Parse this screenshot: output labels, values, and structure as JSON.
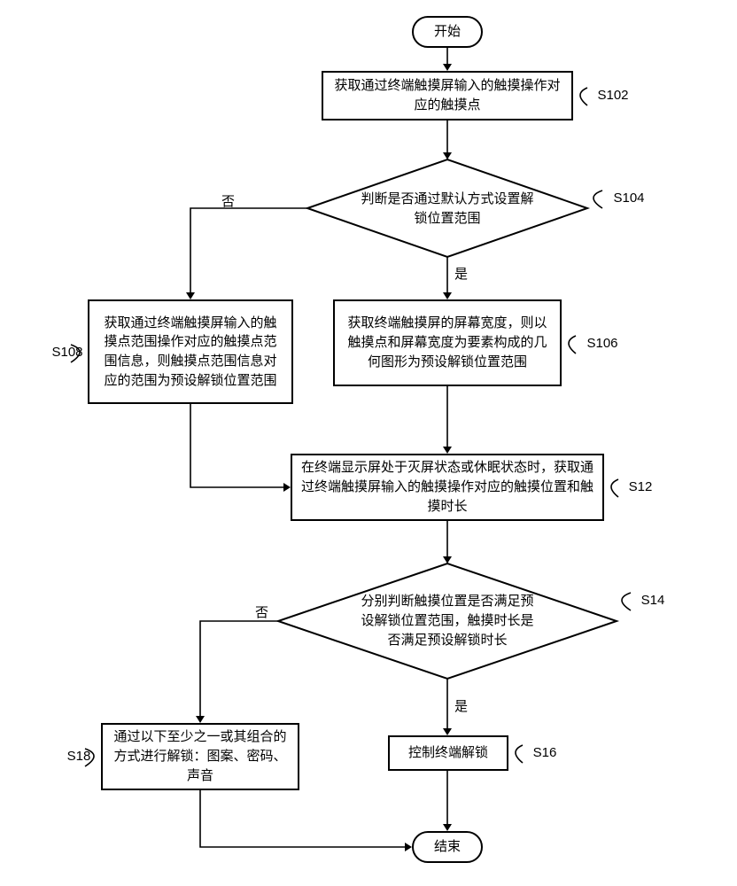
{
  "terminals": {
    "start": "开始",
    "end": "结束"
  },
  "steps": {
    "s102": {
      "id": "S102",
      "text": "获取通过终端触摸屏输入的触摸操作对应的触摸点"
    },
    "s104": {
      "id": "S104",
      "text": "判断是否通过默认方式设置解锁位置范围"
    },
    "s106": {
      "id": "S106",
      "text": "获取终端触摸屏的屏幕宽度，则以触摸点和屏幕宽度为要素构成的几何图形为预设解锁位置范围"
    },
    "s108": {
      "id": "S108",
      "text": "获取通过终端触摸屏输入的触摸点范围操作对应的触摸点范围信息，则触摸点范围信息对应的范围为预设解锁位置范围"
    },
    "s12": {
      "id": "S12",
      "text": "在终端显示屏处于灭屏状态或休眠状态时，获取通过终端触摸屏输入的触摸操作对应的触摸位置和触摸时长"
    },
    "s14": {
      "id": "S14",
      "text": "分别判断触摸位置是否满足预设解锁位置范围，触摸时长是否满足预设解锁时长"
    },
    "s16": {
      "id": "S16",
      "text": "控制终端解锁"
    },
    "s18": {
      "id": "S18",
      "text": "通过以下至少之一或其组合的方式进行解锁：图案、密码、声音"
    }
  },
  "edges": {
    "yes": "是",
    "no": "否"
  }
}
